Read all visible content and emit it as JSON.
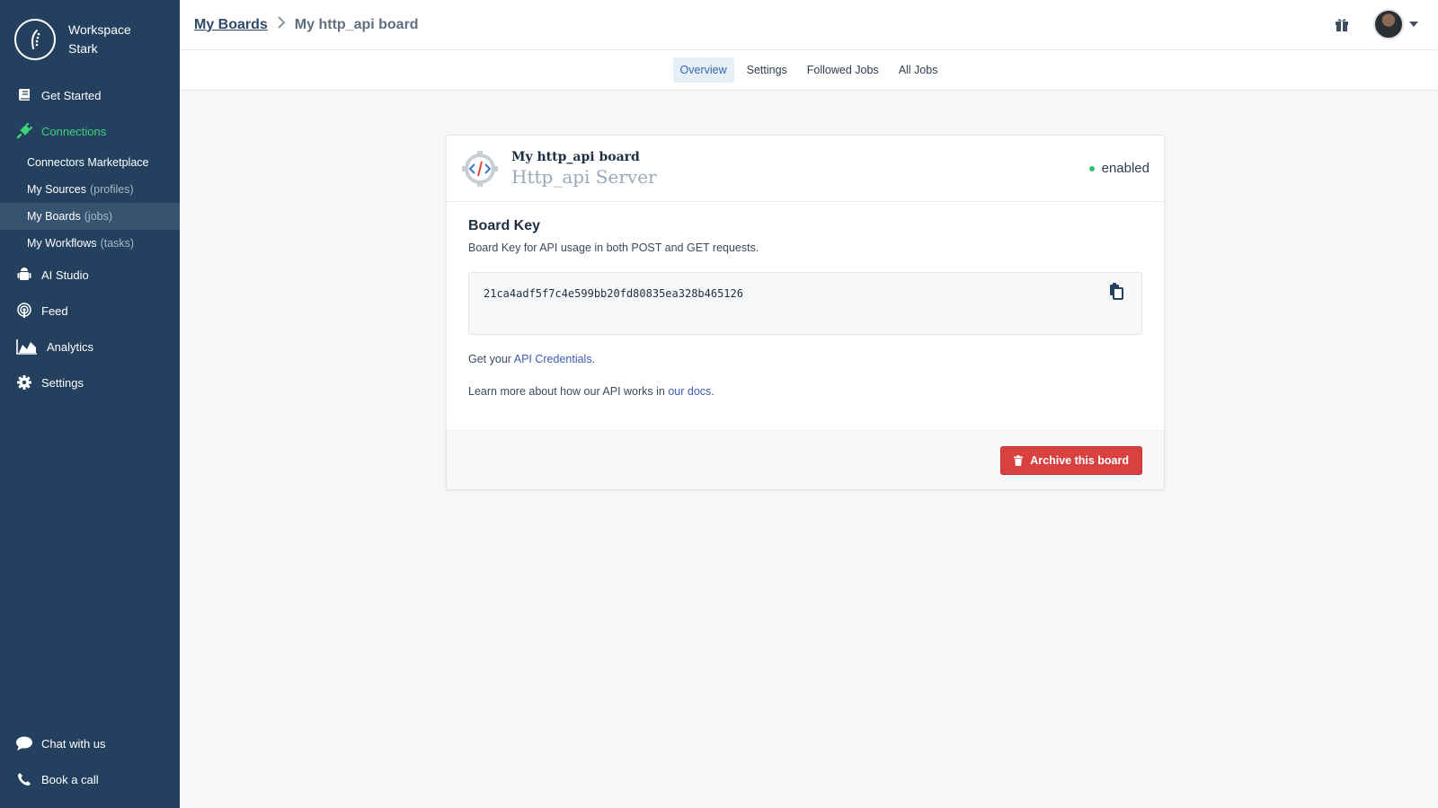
{
  "workspace": {
    "name": "Workspace Stark",
    "logo_icon": "hrflow-logo-icon"
  },
  "sidebar": {
    "items": [
      {
        "label": "Get Started",
        "icon": "book-icon"
      },
      {
        "label": "Connections",
        "icon": "plug-icon",
        "active": true
      },
      {
        "label": "AI Studio",
        "icon": "robot-icon"
      },
      {
        "label": "Feed",
        "icon": "podcast-icon"
      },
      {
        "label": "Analytics",
        "icon": "area-chart-icon"
      },
      {
        "label": "Settings",
        "icon": "gear-icon"
      }
    ],
    "sub_items": [
      {
        "label": "Connectors Marketplace",
        "muted": ""
      },
      {
        "label": "My Sources",
        "muted": "(profiles)"
      },
      {
        "label": "My Boards",
        "muted": "(jobs)",
        "selected": true
      },
      {
        "label": "My Workflows",
        "muted": "(tasks)"
      }
    ],
    "bottom": [
      {
        "label": "Chat with us",
        "icon": "chat-bubble-icon"
      },
      {
        "label": "Book a call",
        "icon": "phone-icon"
      }
    ],
    "accent_color": "#3dd17a"
  },
  "breadcrumb": {
    "parent": "My Boards",
    "current": "My http_api board"
  },
  "tabs": [
    {
      "label": "Overview",
      "active": true
    },
    {
      "label": "Settings"
    },
    {
      "label": "Followed Jobs"
    },
    {
      "label": "All Jobs"
    }
  ],
  "card": {
    "title": "My http_api board",
    "subtitle": "Http_api Server",
    "status": "enabled",
    "status_color": "#2fbf71",
    "section_title": "Board Key",
    "section_desc": "Board Key for API usage in both POST and GET requests.",
    "board_key": "21ca4adf5f7c4e599bb20fd80835ea328b465126",
    "credentials_prefix": "Get your ",
    "credentials_link": "API Credentials",
    "credentials_suffix": ".",
    "docs_prefix": "Learn more about how our API works in ",
    "docs_link": "our docs",
    "docs_suffix": ".",
    "archive_label": "Archive this board",
    "archive_color": "#d94040"
  }
}
